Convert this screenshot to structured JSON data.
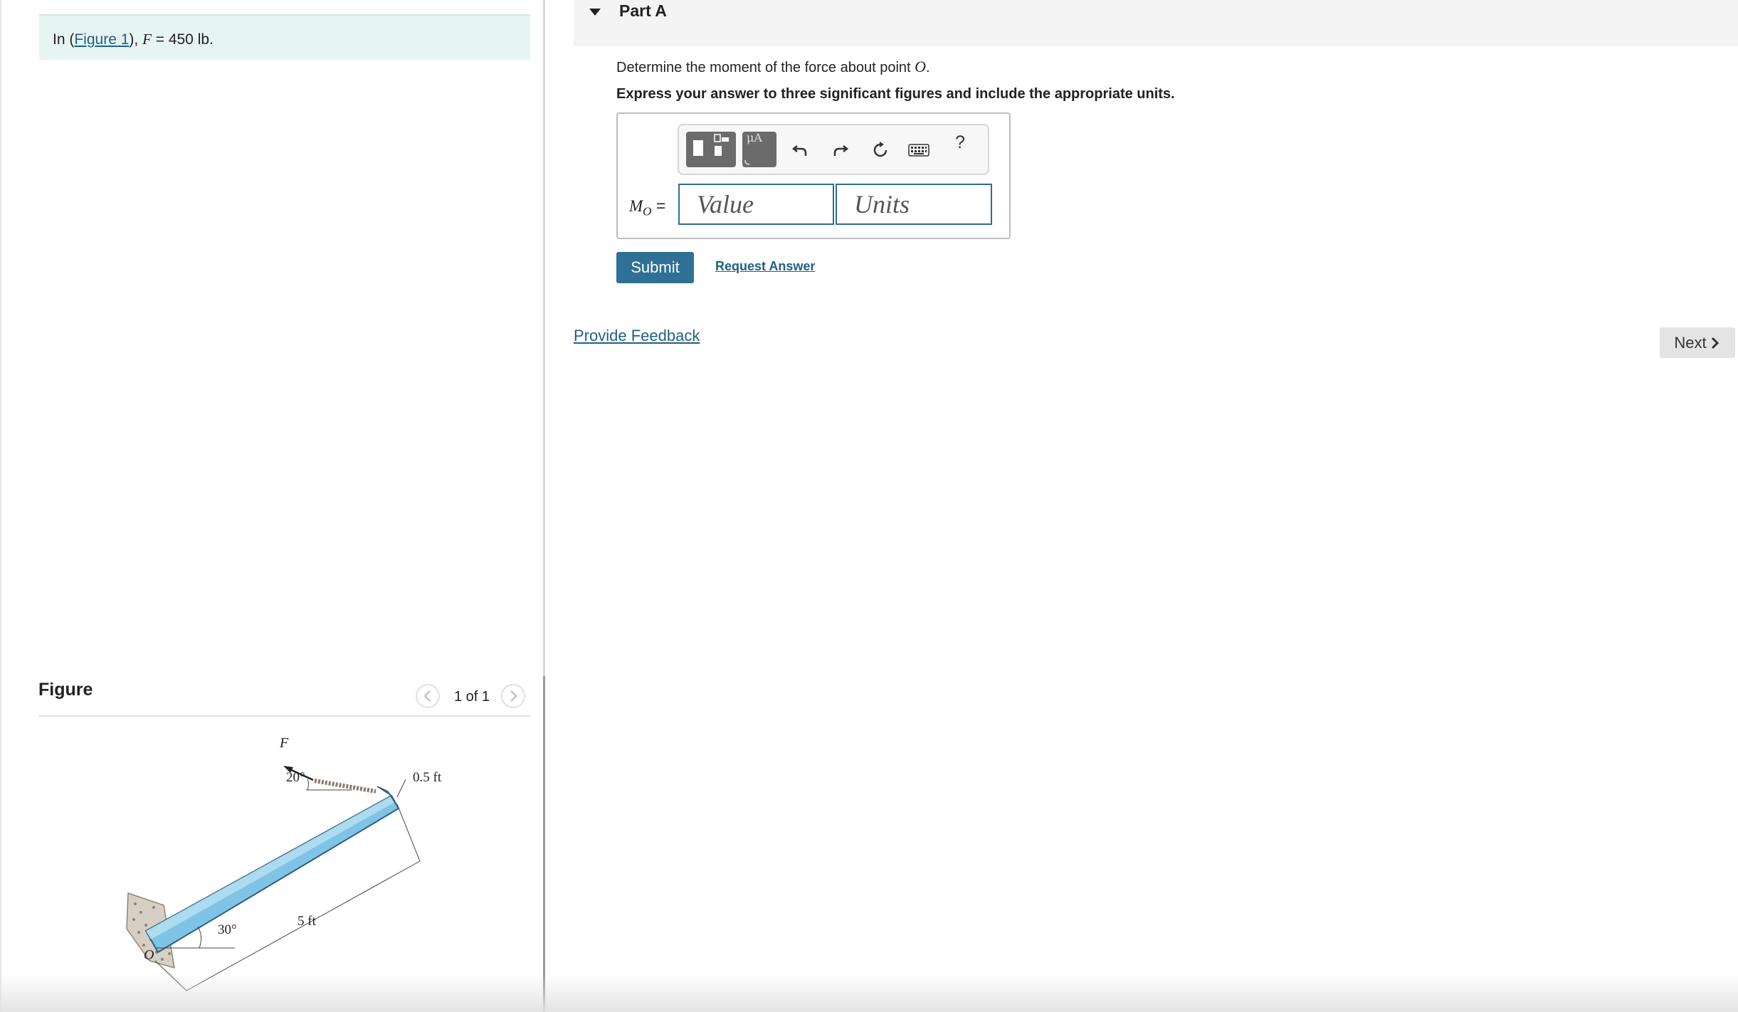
{
  "problem": {
    "prefix": "In (",
    "figure_link": "Figure 1",
    "suffix": "), ",
    "var": "F",
    "equals": " = 450 lb."
  },
  "figure_panel": {
    "title": "Figure",
    "pager_text": "1 of 1",
    "labels": {
      "force": "F",
      "angle_force": "20°",
      "offset": "0.5 ft",
      "length": "5 ft",
      "angle_base": "30°",
      "point": "O"
    }
  },
  "part": {
    "title": "Part A",
    "question_prefix": "Determine the moment of the force about point ",
    "question_var": "O",
    "question_suffix": ".",
    "instruction": "Express your answer to three significant figures and include the appropriate units."
  },
  "answer": {
    "label_main": "M",
    "label_sub": "O",
    "label_eq": " =",
    "value_placeholder": "Value",
    "units_placeholder": "Units",
    "toolbar": {
      "symbols_label": "μA",
      "help_label": "?",
      "icons": [
        "templates-icon",
        "symbols-icon",
        "undo-icon",
        "redo-icon",
        "reset-icon",
        "keyboard-icon"
      ]
    },
    "submit_label": "Submit",
    "request_answer_label": "Request Answer"
  },
  "footer": {
    "feedback_label": "Provide Feedback",
    "next_label": "Next"
  },
  "colors": {
    "accent": "#2f7095",
    "link": "#1f5f86",
    "problem_bg": "#e6f4f2",
    "beam": "#7fc4e6"
  }
}
